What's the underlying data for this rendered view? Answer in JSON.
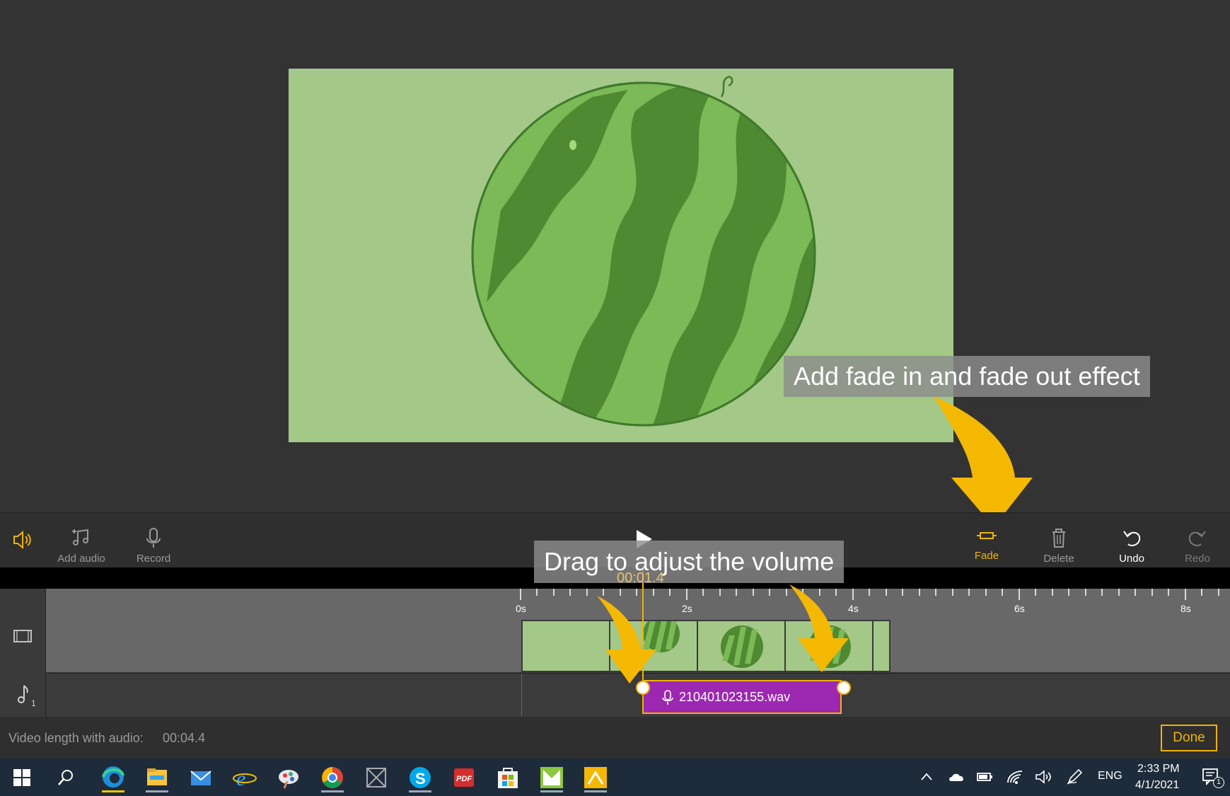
{
  "toolbar": {
    "add_audio": "Add audio",
    "record": "Record",
    "fade": "Fade",
    "delete": "Delete",
    "undo": "Undo",
    "redo": "Redo"
  },
  "timeline": {
    "current_time": "00:01.4",
    "ticks": [
      "0s",
      "2s",
      "4s",
      "6s",
      "8s"
    ],
    "audio_clip": "210401023155.wav",
    "audio_track_number": "1"
  },
  "callouts": {
    "fade": "Add fade in and fade out effect",
    "volume": "Drag to adjust the volume"
  },
  "status": {
    "video_length_label": "Video length with audio:",
    "video_length_value": "00:04.4",
    "done": "Done"
  },
  "taskbar": {
    "language": "ENG",
    "time": "2:33 PM",
    "date": "4/1/2021",
    "notification_count": "1",
    "apps": [
      "edge-icon",
      "file-explorer-icon",
      "mail-icon",
      "internet-explorer-icon",
      "paint-icon",
      "chrome-icon",
      "app-icon",
      "skype-icon",
      "pdf-icon",
      "store-icon",
      "photos-icon",
      "app-icon-2"
    ]
  },
  "colors": {
    "accent": "#f0b400",
    "audio_clip": "#9c27b0",
    "preview_bg": "#a3c887"
  }
}
